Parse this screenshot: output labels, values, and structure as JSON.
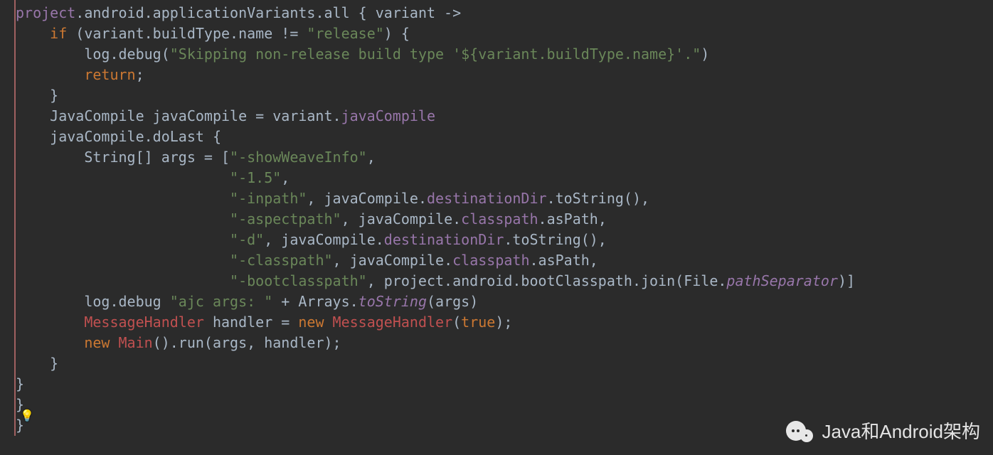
{
  "code": {
    "l1": {
      "a": "project",
      "b": ".android.applicationVariants.all { variant ->"
    },
    "l2": {
      "a": "    ",
      "kw": "if",
      "b": " (variant.buildType.name != ",
      "str": "\"release\"",
      "c": ") {"
    },
    "l3": {
      "a": "        log.debug(",
      "str": "\"Skipping non-release build type '${variant.buildType.name}'.\"",
      "b": ")"
    },
    "l4": {
      "a": "        ",
      "kw": "return",
      "b": ";"
    },
    "l5": {
      "a": "    }"
    },
    "l6": {
      "a": "    JavaCompile javaCompile = variant.",
      "p": "javaCompile"
    },
    "l7": {
      "a": "    javaCompile.doLast {"
    },
    "l8": {
      "a": "        String[] args = [",
      "s": "\"-showWeaveInfo\"",
      "b": ","
    },
    "l9": {
      "a": "                         ",
      "s": "\"-1.5\"",
      "b": ","
    },
    "l10": {
      "a": "                         ",
      "s": "\"-inpath\"",
      "b": ", javaCompile.",
      "p": "destinationDir",
      "c": ".toString(),"
    },
    "l11": {
      "a": "                         ",
      "s": "\"-aspectpath\"",
      "b": ", javaCompile.",
      "p": "classpath",
      "c": ".asPath,"
    },
    "l12": {
      "a": "                         ",
      "s": "\"-d\"",
      "b": ", javaCompile.",
      "p": "destinationDir",
      "c": ".toString(),"
    },
    "l13": {
      "a": "                         ",
      "s": "\"-classpath\"",
      "b": ", javaCompile.",
      "p": "classpath",
      "c": ".asPath,"
    },
    "l14": {
      "a": "                         ",
      "s": "\"-bootclasspath\"",
      "b": ", project.android.bootClasspath.join(File.",
      "p": "pathSeparator",
      "c": ")]"
    },
    "l15": {
      "a": "        log.debug ",
      "s": "\"ajc args: \"",
      "b": " + Arrays.",
      "p": "toString",
      "c": "(args)"
    },
    "l16": {
      "a": "        ",
      "cls": "MessageHandler",
      "b": " handler = ",
      "kw": "new",
      "c": " ",
      "cls2": "MessageHandler",
      "d": "(",
      "kw2": "true",
      "e": ");"
    },
    "l17": {
      "a": "        ",
      "kw": "new",
      "b": " ",
      "cls": "Main",
      "c": "().run(args, handler);"
    },
    "l18": {
      "a": "    }"
    },
    "l19": {
      "a": "}"
    },
    "l20": {
      "a": "}"
    },
    "l21": {
      "a": "}"
    }
  },
  "watermark": "Java和Android架构"
}
